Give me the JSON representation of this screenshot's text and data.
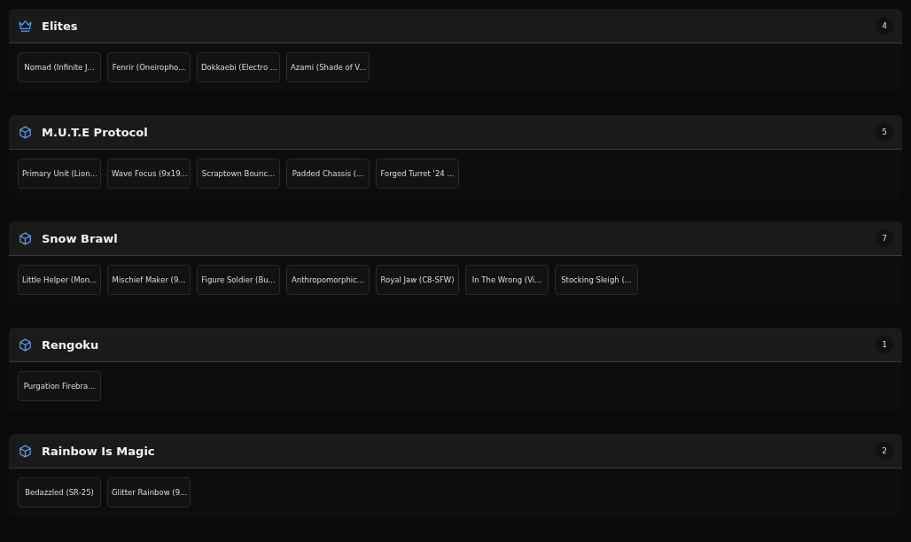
{
  "groups": [
    {
      "title": "Elites",
      "kind": "crown",
      "count": "4",
      "items": [
        "Nomad (Infinite J...",
        "Fenrir (Oneiropho...",
        "Dokkaebi (Electro ...",
        "Azami (Shade of V..."
      ]
    },
    {
      "title": "M.U.T.E Protocol",
      "kind": "cube",
      "count": "5",
      "items": [
        "Primary Unit (Lion...",
        "Wave Focus (9x19...",
        "Scraptown Bounc...",
        "Padded Chassis (...",
        "Forged Turret '24 ..."
      ]
    },
    {
      "title": "Snow Brawl",
      "kind": "cube",
      "count": "7",
      "items": [
        "Little Helper (Mon...",
        "Mischief Maker (9...",
        "Figure Soldier (Bu...",
        "Anthropomorphic...",
        "Royal Jaw (C8-SFW)",
        "In The Wrong (Vi...",
        "Stocking Sleigh (..."
      ]
    },
    {
      "title": "Rengoku",
      "kind": "cube",
      "count": "1",
      "items": [
        "Purgation Firebra..."
      ]
    },
    {
      "title": "Rainbow Is Magic",
      "kind": "cube",
      "count": "2",
      "items": [
        "Bedazzled (SR-25)",
        "Glitter Rainbow (9..."
      ]
    }
  ]
}
